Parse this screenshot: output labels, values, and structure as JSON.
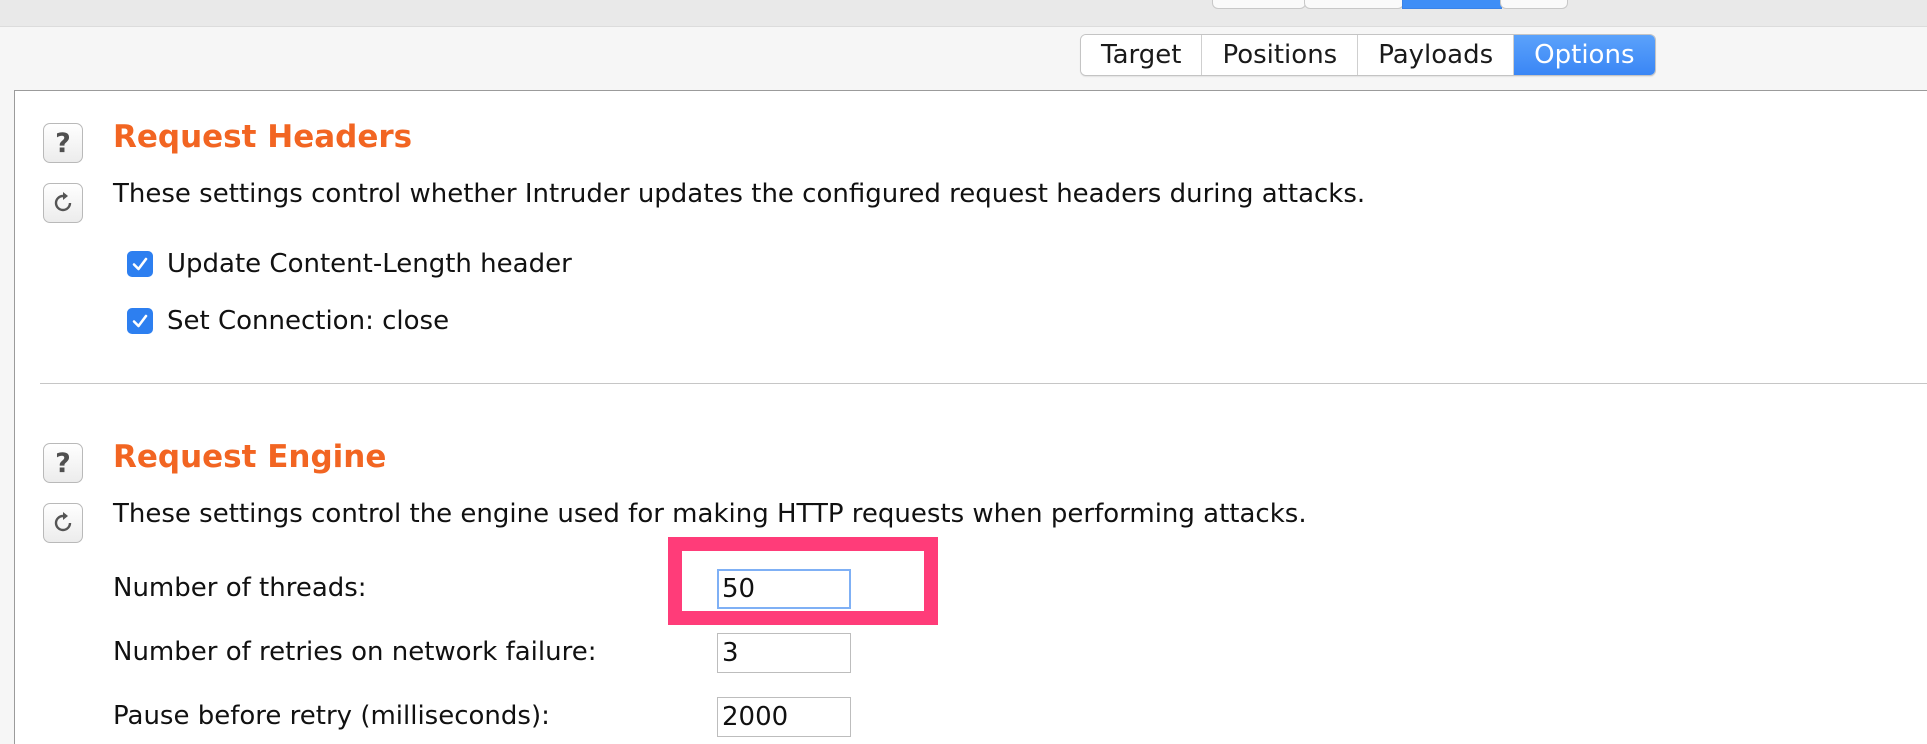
{
  "tabs": [
    {
      "label": "Target",
      "active": false
    },
    {
      "label": "Positions",
      "active": false
    },
    {
      "label": "Payloads",
      "active": false
    },
    {
      "label": "Options",
      "active": true
    }
  ],
  "request_headers": {
    "title": "Request Headers",
    "description": "These settings control whether Intruder updates the configured request headers during attacks.",
    "options": [
      {
        "label": "Update Content-Length header",
        "checked": true
      },
      {
        "label": "Set Connection: close",
        "checked": true
      }
    ]
  },
  "request_engine": {
    "title": "Request Engine",
    "description": "These settings control the engine used for making HTTP requests when performing attacks.",
    "fields": [
      {
        "label": "Number of threads:",
        "value": "50"
      },
      {
        "label": "Number of retries on network failure:",
        "value": "3"
      },
      {
        "label": "Pause before retry (milliseconds):",
        "value": "2000"
      }
    ]
  },
  "icons": {
    "help": "help-icon",
    "restore": "restore-defaults-icon"
  },
  "colors": {
    "section_title": "#f26522",
    "active_tab": "#3a86f5",
    "checkbox": "#2d7ff0",
    "highlight": "#ff3c79"
  }
}
